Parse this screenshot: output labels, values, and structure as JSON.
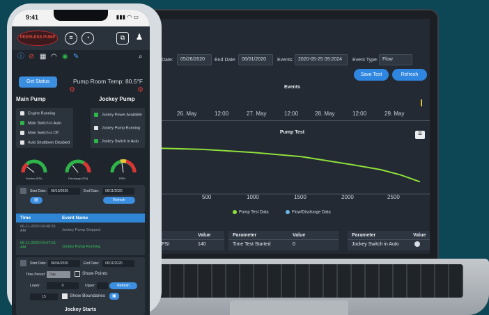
{
  "laptop": {
    "toolbar": {
      "start_date_label": "Date:",
      "start_date": "05/26/2020",
      "end_date_label": "End Date:",
      "end_date": "06/01/2020",
      "events_label": "Events:",
      "events_value": "2020-05-25 09:2024",
      "event_type_label": "Event Type:",
      "event_type_value": "Flow",
      "save_test": "Save Test",
      "refresh": "Refresh"
    },
    "events_chart": {
      "title": "Events",
      "ticks": [
        "26. May",
        "12:00",
        "27. May",
        "12:00",
        "28. May",
        "12:00",
        "29. May"
      ]
    },
    "pump_chart": {
      "title": "Pump Test",
      "x_ticks": [
        "500",
        "1000",
        "1500",
        "2000",
        "2500"
      ],
      "legend": [
        "Pump Test Data",
        "Flow/Discharge Data"
      ]
    },
    "tables": {
      "t1": {
        "headers": [
          "",
          "Value"
        ],
        "row": [
          "t PSI",
          "140"
        ]
      },
      "t2": {
        "headers": [
          "Parameter",
          "Value"
        ],
        "row": [
          "Time Test Started",
          "0"
        ]
      },
      "t3": {
        "headers": [
          "Parameter",
          "Value"
        ],
        "row": [
          "Jockey Switch in Auto",
          ""
        ]
      }
    },
    "colors": {
      "accent": "#2f86e0",
      "series": "#8fe03a"
    }
  },
  "chart_data": {
    "type": "line",
    "title": "Pump Test",
    "x_ticks": [
      500,
      1000,
      1500,
      2000,
      2500
    ],
    "series": [
      {
        "name": "Pump Test Data",
        "x": [
          0,
          500,
          1000,
          1500,
          2000,
          2300,
          2500,
          2700
        ],
        "y": [
          1.0,
          0.97,
          0.9,
          0.8,
          0.62,
          0.5,
          0.38,
          0.22
        ]
      }
    ],
    "legend": [
      "Pump Test Data",
      "Flow/Discharge Data"
    ]
  },
  "phone": {
    "time": "9:41",
    "logo_text": "PEERLESS PUMP",
    "get_status": "Get Status",
    "room_temp": "Pump Room Temp: 80.5°F",
    "main_pump": {
      "title": "Main Pump",
      "items": [
        {
          "label": "Engine Running",
          "state": "off"
        },
        {
          "label": "Main Switch in Auto",
          "state": "on"
        },
        {
          "label": "Main Switch is Off",
          "state": "off"
        },
        {
          "label": "Auto Shutdown Disabled",
          "state": "off"
        }
      ]
    },
    "jockey_pump": {
      "title": "Jockey Pump",
      "items": [
        {
          "label": "Jockey Power Available",
          "state": "on"
        },
        {
          "label": "Jockey Pump Running",
          "state": "off"
        },
        {
          "label": "Jockey Switch in Auto",
          "state": "on"
        }
      ]
    },
    "gauges": [
      "Suction (PSI)",
      "Discharge (PSI)",
      "RPM"
    ],
    "filter1": {
      "start_label": "Start Date:",
      "start": "06/10/2020",
      "end_label": "End Date:",
      "end": "06/11/2020",
      "refresh": "Refresh"
    },
    "events_table": {
      "headers": [
        "Time",
        "Event Name"
      ],
      "rows": [
        {
          "time": "06-11-2020 04:48:35 AM",
          "event": "Jockey Pump Stopped",
          "color": "#8f9aa6"
        },
        {
          "time": "06-11-2020 04:47:16 AM",
          "event": "Jockey Pump Running",
          "color": "#34c759"
        }
      ]
    },
    "filter2": {
      "start_label": "Start Date:",
      "start": "06/04/2020",
      "end_label": "End Date:",
      "end": "06/11/2020",
      "time_period_label": "Time Period:",
      "time_period": "Day",
      "show_points": "Show Points",
      "lower_label": "Lower:",
      "lower": "0",
      "upper_label": "Upper:",
      "refresh": "Refresh",
      "interval": "15",
      "show_boundaries": "Show Boundaries"
    },
    "chart_title": "Jockey Starts"
  }
}
